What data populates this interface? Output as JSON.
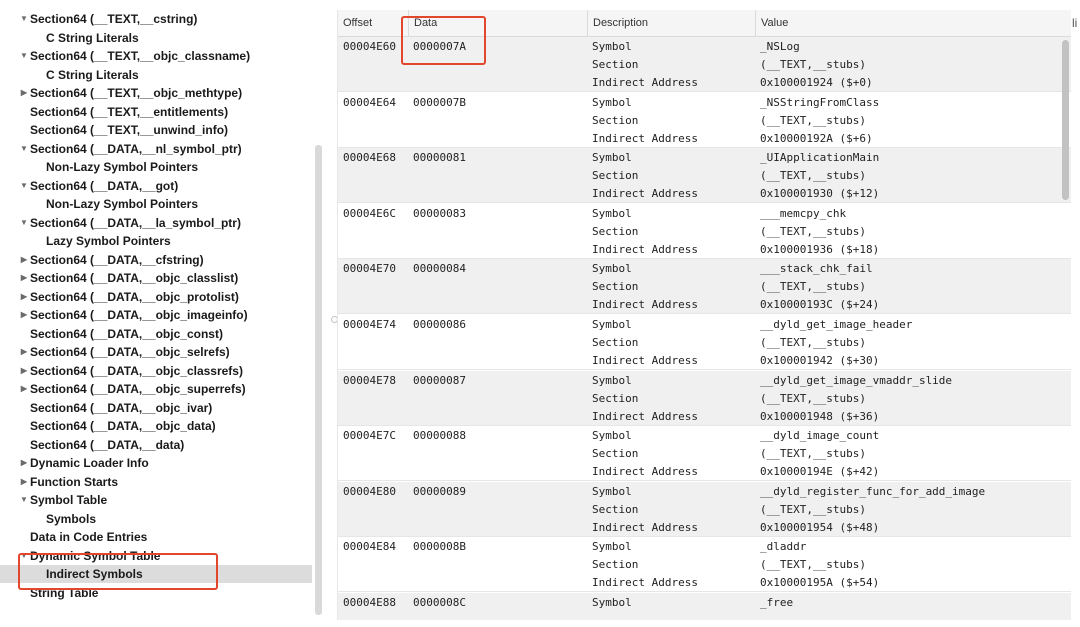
{
  "tree": {
    "items": [
      {
        "label": "Section64 (__TEXT,__cstring)",
        "indent": 1,
        "disclosure": "▼"
      },
      {
        "label": "C String Literals",
        "indent": 2,
        "disclosure": ""
      },
      {
        "label": "Section64 (__TEXT,__objc_classname)",
        "indent": 1,
        "disclosure": "▼"
      },
      {
        "label": "C String Literals",
        "indent": 2,
        "disclosure": ""
      },
      {
        "label": "Section64 (__TEXT,__objc_methtype)",
        "indent": 1,
        "disclosure": "▶"
      },
      {
        "label": "Section64 (__TEXT,__entitlements)",
        "indent": 1,
        "disclosure": ""
      },
      {
        "label": "Section64 (__TEXT,__unwind_info)",
        "indent": 1,
        "disclosure": ""
      },
      {
        "label": "Section64 (__DATA,__nl_symbol_ptr)",
        "indent": 1,
        "disclosure": "▼"
      },
      {
        "label": "Non-Lazy Symbol Pointers",
        "indent": 2,
        "disclosure": ""
      },
      {
        "label": "Section64 (__DATA,__got)",
        "indent": 1,
        "disclosure": "▼"
      },
      {
        "label": "Non-Lazy Symbol Pointers",
        "indent": 2,
        "disclosure": ""
      },
      {
        "label": "Section64 (__DATA,__la_symbol_ptr)",
        "indent": 1,
        "disclosure": "▼"
      },
      {
        "label": "Lazy Symbol Pointers",
        "indent": 2,
        "disclosure": ""
      },
      {
        "label": "Section64 (__DATA,__cfstring)",
        "indent": 1,
        "disclosure": "▶"
      },
      {
        "label": "Section64 (__DATA,__objc_classlist)",
        "indent": 1,
        "disclosure": "▶"
      },
      {
        "label": "Section64 (__DATA,__objc_protolist)",
        "indent": 1,
        "disclosure": "▶"
      },
      {
        "label": "Section64 (__DATA,__objc_imageinfo)",
        "indent": 1,
        "disclosure": "▶"
      },
      {
        "label": "Section64 (__DATA,__objc_const)",
        "indent": 1,
        "disclosure": ""
      },
      {
        "label": "Section64 (__DATA,__objc_selrefs)",
        "indent": 1,
        "disclosure": "▶"
      },
      {
        "label": "Section64 (__DATA,__objc_classrefs)",
        "indent": 1,
        "disclosure": "▶"
      },
      {
        "label": "Section64 (__DATA,__objc_superrefs)",
        "indent": 1,
        "disclosure": "▶"
      },
      {
        "label": "Section64 (__DATA,__objc_ivar)",
        "indent": 1,
        "disclosure": ""
      },
      {
        "label": "Section64 (__DATA,__objc_data)",
        "indent": 1,
        "disclosure": ""
      },
      {
        "label": "Section64 (__DATA,__data)",
        "indent": 1,
        "disclosure": ""
      },
      {
        "label": "Dynamic Loader Info",
        "indent": 1,
        "disclosure": "▶"
      },
      {
        "label": "Function Starts",
        "indent": 1,
        "disclosure": "▶"
      },
      {
        "label": "Symbol Table",
        "indent": 1,
        "disclosure": "▼"
      },
      {
        "label": "Symbols",
        "indent": 2,
        "disclosure": ""
      },
      {
        "label": "Data in Code Entries",
        "indent": 1,
        "disclosure": ""
      },
      {
        "label": "Dynamic Symbol Table",
        "indent": 1,
        "disclosure": "▼"
      },
      {
        "label": "Indirect Symbols",
        "indent": 2,
        "disclosure": "",
        "selected": true
      },
      {
        "label": "String Table",
        "indent": 1,
        "disclosure": ""
      }
    ]
  },
  "table": {
    "columns": [
      "Offset",
      "Data",
      "Description",
      "Value"
    ],
    "entries": [
      {
        "offset": "00004E60",
        "data": "0000007A",
        "rows": [
          {
            "desc": "Symbol",
            "value": "_NSLog"
          },
          {
            "desc": "Section",
            "value": "(__TEXT,__stubs)"
          },
          {
            "desc": "Indirect Address",
            "value": "0x100001924 ($+0)"
          }
        ]
      },
      {
        "offset": "00004E64",
        "data": "0000007B",
        "rows": [
          {
            "desc": "Symbol",
            "value": "_NSStringFromClass"
          },
          {
            "desc": "Section",
            "value": "(__TEXT,__stubs)"
          },
          {
            "desc": "Indirect Address",
            "value": "0x10000192A ($+6)"
          }
        ]
      },
      {
        "offset": "00004E68",
        "data": "00000081",
        "rows": [
          {
            "desc": "Symbol",
            "value": "_UIApplicationMain"
          },
          {
            "desc": "Section",
            "value": "(__TEXT,__stubs)"
          },
          {
            "desc": "Indirect Address",
            "value": "0x100001930 ($+12)"
          }
        ]
      },
      {
        "offset": "00004E6C",
        "data": "00000083",
        "rows": [
          {
            "desc": "Symbol",
            "value": "___memcpy_chk"
          },
          {
            "desc": "Section",
            "value": "(__TEXT,__stubs)"
          },
          {
            "desc": "Indirect Address",
            "value": "0x100001936 ($+18)"
          }
        ]
      },
      {
        "offset": "00004E70",
        "data": "00000084",
        "rows": [
          {
            "desc": "Symbol",
            "value": "___stack_chk_fail"
          },
          {
            "desc": "Section",
            "value": "(__TEXT,__stubs)"
          },
          {
            "desc": "Indirect Address",
            "value": "0x10000193C ($+24)"
          }
        ]
      },
      {
        "offset": "00004E74",
        "data": "00000086",
        "rows": [
          {
            "desc": "Symbol",
            "value": "__dyld_get_image_header"
          },
          {
            "desc": "Section",
            "value": "(__TEXT,__stubs)"
          },
          {
            "desc": "Indirect Address",
            "value": "0x100001942 ($+30)"
          }
        ]
      },
      {
        "offset": "00004E78",
        "data": "00000087",
        "rows": [
          {
            "desc": "Symbol",
            "value": "__dyld_get_image_vmaddr_slide"
          },
          {
            "desc": "Section",
            "value": "(__TEXT,__stubs)"
          },
          {
            "desc": "Indirect Address",
            "value": "0x100001948 ($+36)"
          }
        ]
      },
      {
        "offset": "00004E7C",
        "data": "00000088",
        "rows": [
          {
            "desc": "Symbol",
            "value": "__dyld_image_count"
          },
          {
            "desc": "Section",
            "value": "(__TEXT,__stubs)"
          },
          {
            "desc": "Indirect Address",
            "value": "0x10000194E ($+42)"
          }
        ]
      },
      {
        "offset": "00004E80",
        "data": "00000089",
        "rows": [
          {
            "desc": "Symbol",
            "value": "__dyld_register_func_for_add_image"
          },
          {
            "desc": "Section",
            "value": "(__TEXT,__stubs)"
          },
          {
            "desc": "Indirect Address",
            "value": "0x100001954 ($+48)"
          }
        ]
      },
      {
        "offset": "00004E84",
        "data": "0000008B",
        "rows": [
          {
            "desc": "Symbol",
            "value": "_dladdr"
          },
          {
            "desc": "Section",
            "value": "(__TEXT,__stubs)"
          },
          {
            "desc": "Indirect Address",
            "value": "0x10000195A ($+54)"
          }
        ]
      },
      {
        "offset": "00004E88",
        "data": "0000008C",
        "rows": [
          {
            "desc": "Symbol",
            "value": "_free"
          }
        ]
      }
    ]
  },
  "cutoff_text": "li",
  "colors": {
    "highlight": "#e2462d",
    "selection": "#dcdcdc",
    "alt_row": "#f0f0f0"
  }
}
